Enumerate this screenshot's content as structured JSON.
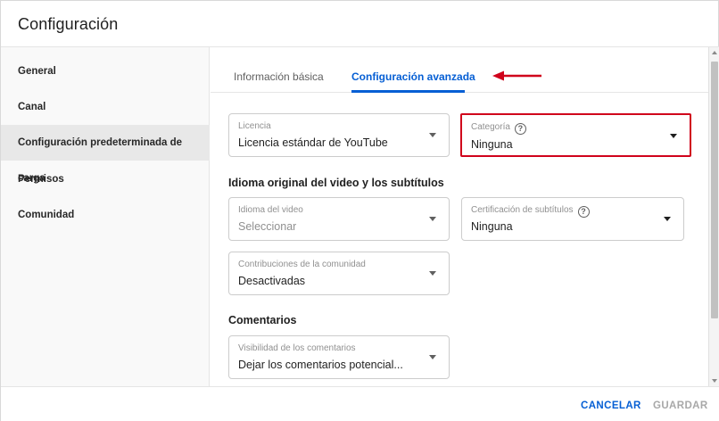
{
  "dialog": {
    "title": "Configuración"
  },
  "sidebar": {
    "items": [
      {
        "label": "General"
      },
      {
        "label": "Canal"
      },
      {
        "label": "Configuración predeterminada de carga",
        "active": true
      },
      {
        "label": "Permisos"
      },
      {
        "label": "Comunidad"
      }
    ]
  },
  "tabs": [
    {
      "label": "Información básica",
      "active": false
    },
    {
      "label": "Configuración avanzada",
      "active": true
    }
  ],
  "annotation": {
    "arrow_color": "#d0021b",
    "highlight_color": "#d0021b"
  },
  "fields": {
    "license": {
      "label": "Licencia",
      "value": "Licencia estándar de YouTube"
    },
    "category": {
      "label": "Categoría",
      "value": "Ninguna",
      "help_icon": "help-circle-icon"
    },
    "video_language": {
      "label": "Idioma del video",
      "value": "Seleccionar"
    },
    "caption_certification": {
      "label": "Certificación de subtítulos",
      "value": "Ninguna",
      "help_icon": "help-circle-icon"
    },
    "community_contributions": {
      "label": "Contribuciones de la comunidad",
      "value": "Desactivadas"
    },
    "comment_visibility": {
      "label": "Visibilidad de los comentarios",
      "value": "Dejar los comentarios potencial..."
    }
  },
  "sections": {
    "language": "Idioma original del video y los subtítulos",
    "comments": "Comentarios"
  },
  "footer": {
    "cancel_label": "CANCELAR",
    "save_label": "GUARDAR"
  },
  "colors": {
    "accent": "#065fd4",
    "disabled": "#a8a8a8"
  }
}
